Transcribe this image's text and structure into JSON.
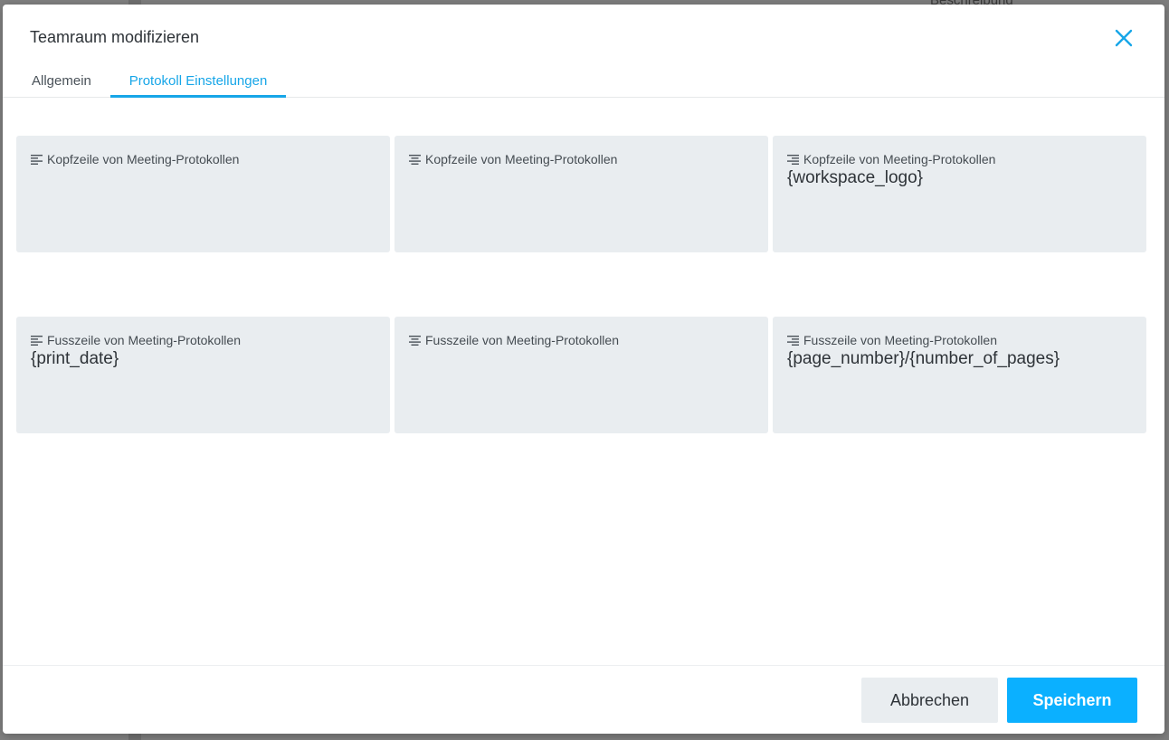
{
  "background": {
    "label": "Beschreibung"
  },
  "dialog": {
    "title": "Teamraum modifizieren",
    "close_icon": "close-icon",
    "accent_color": "#0bb0ff"
  },
  "tabs": [
    {
      "label": "Allgemein",
      "active": false
    },
    {
      "label": "Protokoll Einstellungen",
      "active": true
    }
  ],
  "header_cards": [
    {
      "label": "Kopfzeile von Meeting-Protokollen",
      "align_icon": "align-left-icon",
      "value": ""
    },
    {
      "label": "Kopfzeile von Meeting-Protokollen",
      "align_icon": "align-center-icon",
      "value": ""
    },
    {
      "label": "Kopfzeile von Meeting-Protokollen",
      "align_icon": "align-right-icon",
      "value": "{workspace_logo}"
    }
  ],
  "footer_cards": [
    {
      "label": "Fusszeile von Meeting-Protokollen",
      "align_icon": "align-left-icon",
      "value": "{print_date}"
    },
    {
      "label": "Fusszeile von Meeting-Protokollen",
      "align_icon": "align-center-icon",
      "value": ""
    },
    {
      "label": "Fusszeile von Meeting-Protokollen",
      "align_icon": "align-right-icon",
      "value": "{page_number}/{number_of_pages}"
    }
  ],
  "footer": {
    "cancel_label": "Abbrechen",
    "save_label": "Speichern"
  }
}
